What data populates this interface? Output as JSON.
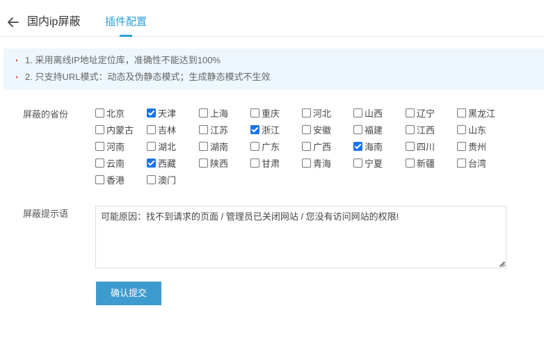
{
  "header": {
    "title": "国内ip屏蔽",
    "tab_label": "插件配置",
    "accent": "#2d9fd8"
  },
  "notice": {
    "lines": [
      "1. 采用离线IP地址定位库，准确性不能达到100%",
      "2. 只支持URL模式：动态及伪静态模式；生成静态模式不生效"
    ]
  },
  "provinces": {
    "label": "屏蔽的省份",
    "items": [
      {
        "name": "北京",
        "checked": false
      },
      {
        "name": "天津",
        "checked": true
      },
      {
        "name": "上海",
        "checked": false
      },
      {
        "name": "重庆",
        "checked": false
      },
      {
        "name": "河北",
        "checked": false
      },
      {
        "name": "山西",
        "checked": false
      },
      {
        "name": "辽宁",
        "checked": false
      },
      {
        "name": "黑龙江",
        "checked": false
      },
      {
        "name": "内蒙古",
        "checked": false
      },
      {
        "name": "吉林",
        "checked": false
      },
      {
        "name": "江苏",
        "checked": false
      },
      {
        "name": "浙江",
        "checked": true
      },
      {
        "name": "安徽",
        "checked": false
      },
      {
        "name": "福建",
        "checked": false
      },
      {
        "name": "江西",
        "checked": false
      },
      {
        "name": "山东",
        "checked": false
      },
      {
        "name": "河南",
        "checked": false
      },
      {
        "name": "湖北",
        "checked": false
      },
      {
        "name": "湖南",
        "checked": false
      },
      {
        "name": "广东",
        "checked": false
      },
      {
        "name": "广西",
        "checked": false
      },
      {
        "name": "海南",
        "checked": true
      },
      {
        "name": "四川",
        "checked": false
      },
      {
        "name": "贵州",
        "checked": false
      },
      {
        "name": "云南",
        "checked": false
      },
      {
        "name": "西藏",
        "checked": true
      },
      {
        "name": "陕西",
        "checked": false
      },
      {
        "name": "甘肃",
        "checked": false
      },
      {
        "name": "青海",
        "checked": false
      },
      {
        "name": "宁夏",
        "checked": false
      },
      {
        "name": "新疆",
        "checked": false
      },
      {
        "name": "台湾",
        "checked": false
      },
      {
        "name": "香港",
        "checked": false
      },
      {
        "name": "澳门",
        "checked": false
      }
    ]
  },
  "message": {
    "label": "屏蔽提示语",
    "value": "可能原因：找不到请求的页面 / 管理员已关闭网站 / 您没有访问网站的权限!"
  },
  "submit_label": "确认提交",
  "icons": {
    "back": "arrow-left-icon"
  }
}
